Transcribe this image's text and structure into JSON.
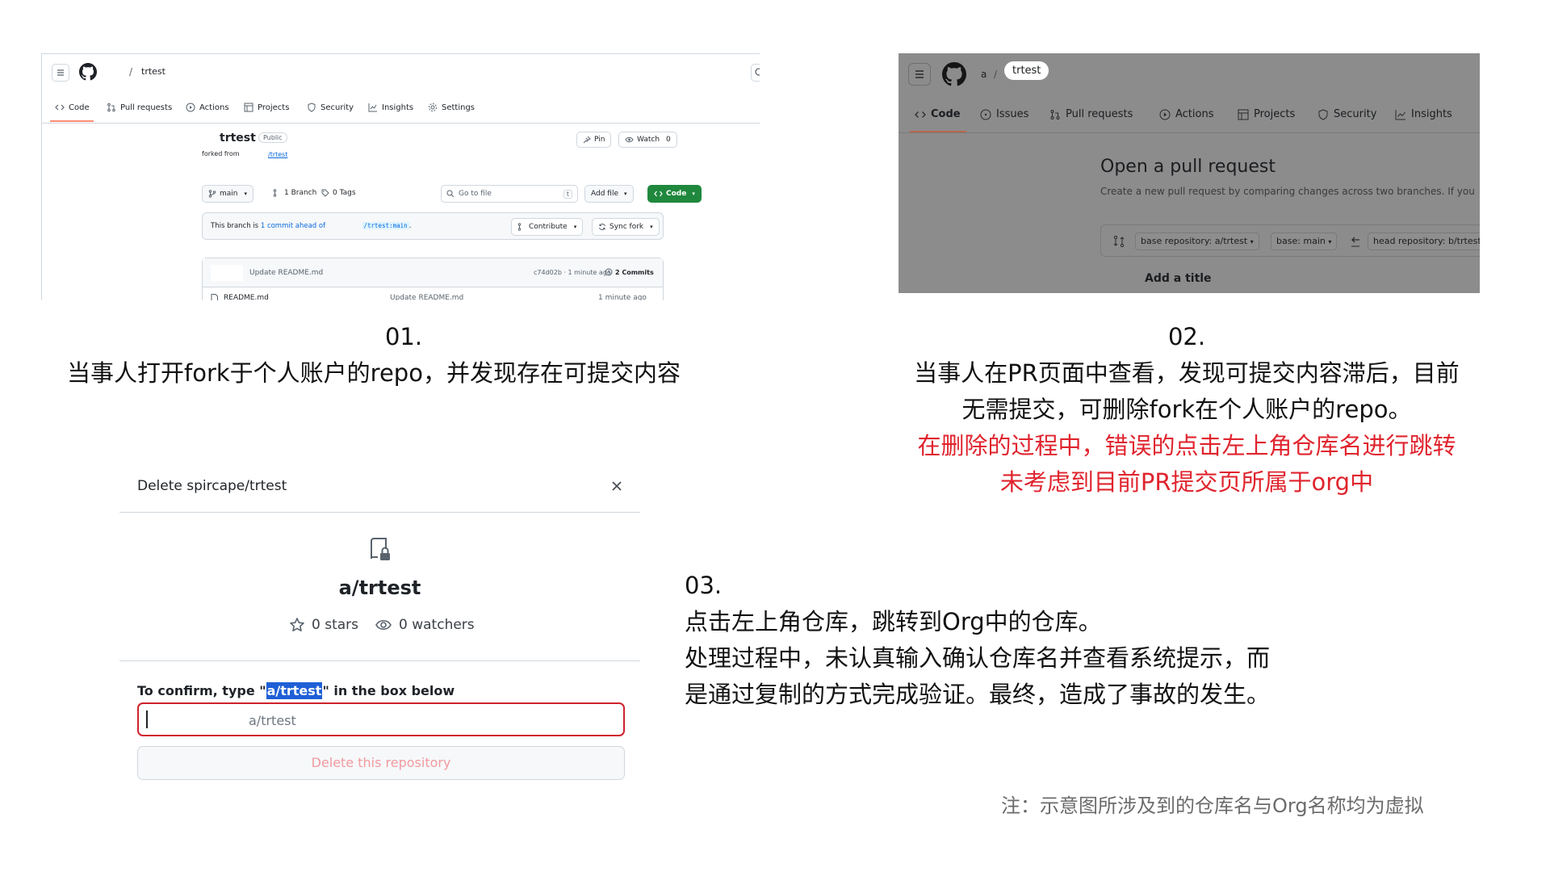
{
  "panel1": {
    "breadcrumb_slash": "/",
    "repo_name": "trtest",
    "tabs": [
      "Code",
      "Pull requests",
      "Actions",
      "Projects",
      "Security",
      "Insights",
      "Settings"
    ],
    "repo_title": "trtest",
    "visibility_badge": "Public",
    "forked_from_label": "forked from",
    "forked_from_link": "/trtest",
    "pin_label": "Pin",
    "watch_label": "Watch",
    "watch_count": "0",
    "branch_selector": "main",
    "branches_count": "1 Branch",
    "tags_count": "0 Tags",
    "go_to_file_placeholder": "Go to file",
    "go_to_file_shortcut": "t",
    "add_file_label": "Add file",
    "code_button_label": "Code",
    "ahead_prefix": "This branch is",
    "ahead_link": "1 commit ahead of",
    "ahead_ref": "/trtest:main",
    "ahead_suffix": ".",
    "contribute_label": "Contribute",
    "sync_fork_label": "Sync fork",
    "last_commit_message": "Update README.md",
    "last_commit_meta": "c74d02b · 1 minute ago",
    "commits_count": "2 Commits",
    "file_name": "README.md",
    "file_commit_message": "Update README.md",
    "file_time": "1 minute ago"
  },
  "panel2": {
    "owner": "a",
    "slash": "/",
    "repo_pill": "trtest",
    "tabs": [
      "Code",
      "Issues",
      "Pull requests",
      "Actions",
      "Projects",
      "Security",
      "Insights"
    ],
    "heading": "Open a pull request",
    "subheading": "Create a new pull request by comparing changes across two branches. If you",
    "base_repo": "base repository: a/trtest",
    "base_branch": "base: main",
    "head_repo": "head repository: b/trtest",
    "add_title_label": "Add a title"
  },
  "panel3": {
    "dialog_title": "Delete spircape/trtest",
    "repo_full_name": "a/trtest",
    "stars": "0 stars",
    "watchers": "0 watchers",
    "confirm_prefix": "To confirm, type \"",
    "confirm_highlight": "a/trtest",
    "confirm_suffix": "\" in the box below",
    "input_value": "a/trtest",
    "delete_button_label": "Delete this repository"
  },
  "captions": {
    "step1_number": "01.",
    "step1_text": "当事人打开fork于个人账户的repo，并发现存在可提交内容",
    "step2_number": "02.",
    "step2_line1": "当事人在PR页面中查看，发现可提交内容滞后，目前",
    "step2_line2": "无需提交，可删除fork在个人账户的repo。",
    "step2_red_line1": "在删除的过程中，错误的点击左上角仓库名进行跳转",
    "step2_red_line2": "未考虑到目前PR提交页所属于org中",
    "step3_number": "03.",
    "step3_line1": "点击左上角仓库，跳转到Org中的仓库。",
    "step3_line2": "处理过程中，未认真输入确认仓库名并查看系统提示，而",
    "step3_line3": "是通过复制的方式完成验证。最终，造成了事故的发生。",
    "note": "注：示意图所涉及到的仓库名与Org名称均为虚拟"
  },
  "colors": {
    "github_green": "#1f883d",
    "link_blue": "#0969da",
    "tab_underline": "#fd8c73",
    "danger_red": "#cf222e",
    "caption_red": "#e0242e",
    "highlight_blue": "#1f5fd6",
    "dim_overlay": "#8c8c8c"
  },
  "icons": [
    "menu-icon",
    "github-logo-icon",
    "code-icon",
    "pull-request-icon",
    "actions-icon",
    "projects-icon",
    "security-icon",
    "insights-icon",
    "settings-icon",
    "issues-icon",
    "pin-icon",
    "eye-icon",
    "branch-icon",
    "tag-icon",
    "search-icon",
    "contribute-icon",
    "sync-icon",
    "history-icon",
    "file-icon",
    "close-icon",
    "repo-lock-icon",
    "star-icon",
    "arrow-left-icon",
    "compare-icon"
  ]
}
